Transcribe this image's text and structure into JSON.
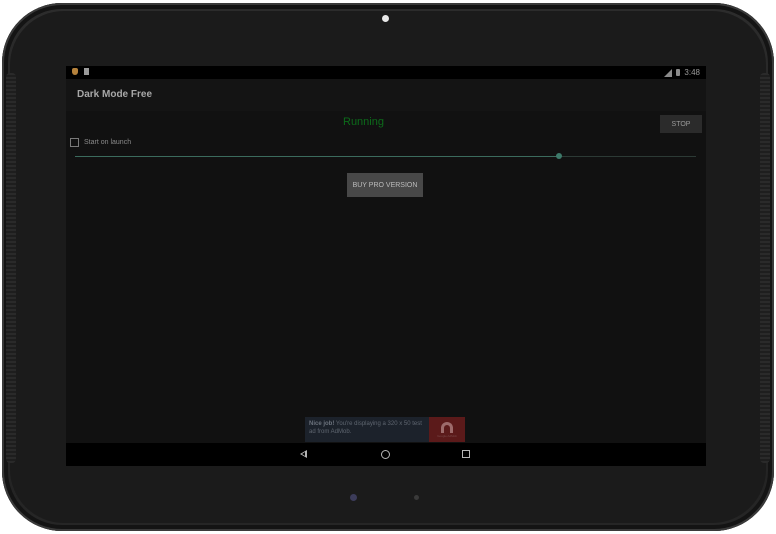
{
  "app": {
    "title": "Dark Mode Free"
  },
  "status_bar": {
    "time": "3:48",
    "icons": [
      "notification-icon",
      "sd-card-icon",
      "signal-icon",
      "battery-icon"
    ]
  },
  "main": {
    "status_text": "Running",
    "stop_label": "STOP",
    "start_on_launch_label": "Start on launch",
    "start_on_launch_checked": false,
    "slider_level": 0.78,
    "buy_pro_label": "BUY PRO VERSION"
  },
  "ad": {
    "bold": "Nice job!",
    "text": " You're displaying a 320 x 50 test ad from AdMob.",
    "logo_text": "Google AdMob"
  },
  "colors": {
    "running": "#0c6b1a",
    "background": "#111111",
    "slider": "#3d7a6a"
  }
}
